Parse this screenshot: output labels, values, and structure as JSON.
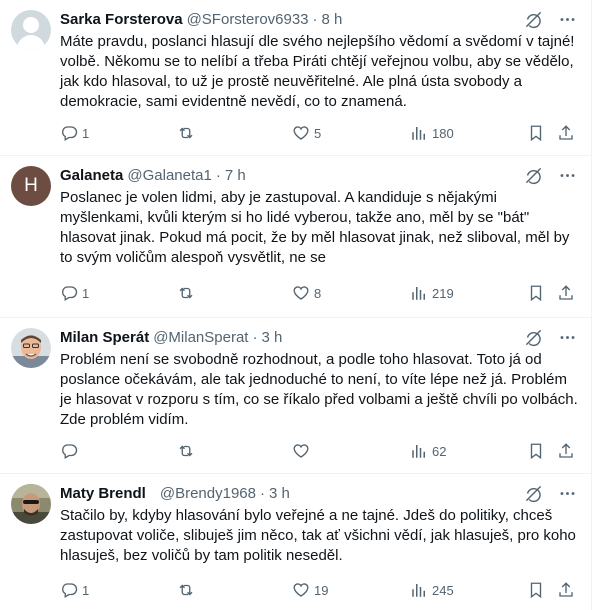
{
  "tweets": [
    {
      "name": "Sarka Forsterova",
      "handle": "@SForsterov6933",
      "separator": "·",
      "time": "8 h",
      "text": "Máte pravdu, poslanci hlasují dle svého nejlepšího vědomí a svědomí v tajné! volbě. Někomu se to nelíbí a třeba Piráti chtějí veřejnou volbu, aby se vědělo, jak kdo hlasoval, to už je prostě neuvěřitelné. Ale plná ústa svobody a demokracie, sami evidentně nevědí, co to znamená.",
      "avatar": "default",
      "replies": "1",
      "reposts": "",
      "likes": "5",
      "views": "180"
    },
    {
      "name": "Galaneta",
      "handle": "@Galaneta1",
      "separator": "·",
      "time": "7 h",
      "text": "Poslanec je volen lidmi, aby je zastupoval. A kandiduje s nějakými myšlenkami, kvůli kterým si ho lidé vyberou, takže ano, měl by se \"bát\" hlasovat jinak. Pokud má pocit, že by měl hlasovat jinak, než sliboval, měl by to svým voličům alespoň vysvětlit, ne se",
      "avatar": "letter",
      "avatar_letter": "H",
      "replies": "1",
      "reposts": "",
      "likes": "8",
      "views": "219"
    },
    {
      "name": "Milan Sperát",
      "handle": "@MilanSperat",
      "separator": "·",
      "time": "3 h",
      "text": "Problém není se svobodně rozhodnout, a podle toho hlasovat. Toto já od poslance očekávám, ale tak jednoduché to není, to víte lépe než já. Problém je hlasovat v rozporu s tím, co se říkalo před volbami a ještě chvíli po volbách. Zde problém vidím.",
      "avatar": "photo",
      "replies": "",
      "reposts": "",
      "likes": "",
      "views": "62"
    },
    {
      "name": "Maty Brendl",
      "handle": "@Brendy1968",
      "separator": "·",
      "time": "3 h",
      "text": "Stačilo by, kdyby hlasování bylo veřejné a ne tajné. Jdeš do politiky, chceš zastupovat voliče, slibuješ jim něco, tak ať všichni vědí, jak hlasuješ, pro koho hlasuješ, bez voličů by tam politik neseděl.",
      "avatar": "photo",
      "replies": "1",
      "reposts": "",
      "likes": "19",
      "views": "245"
    }
  ],
  "colors": {
    "text": "#0f1419",
    "secondary": "#536471",
    "divider": "#eff3f4"
  },
  "icons": [
    "grok-icon",
    "more-icon",
    "reply-icon",
    "repost-icon",
    "like-icon",
    "views-icon",
    "bookmark-icon",
    "share-icon"
  ]
}
